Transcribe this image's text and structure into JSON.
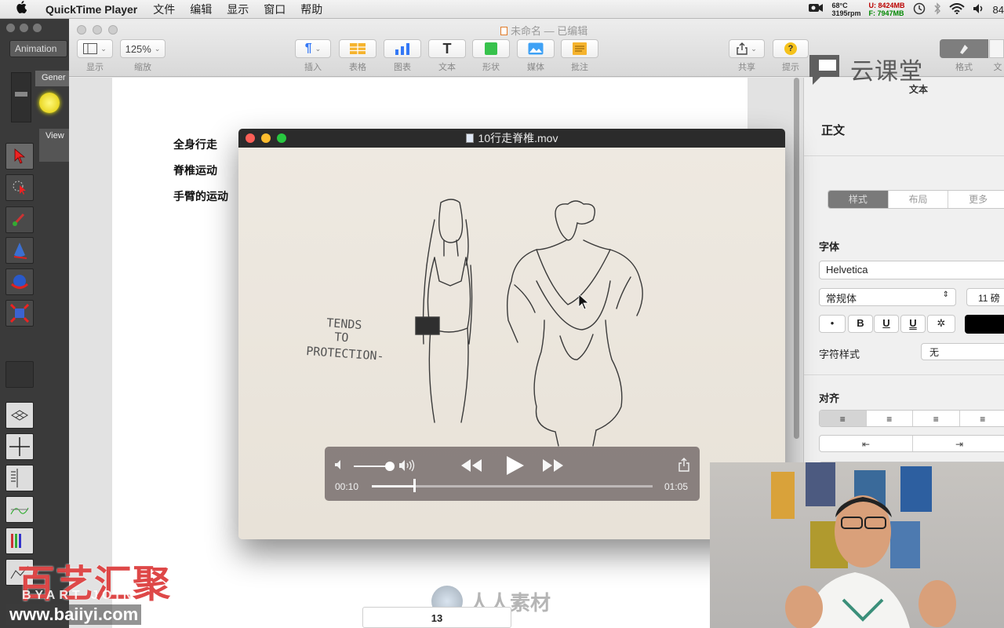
{
  "menubar": {
    "app_name": "QuickTime Player",
    "menus": [
      "文件",
      "编辑",
      "显示",
      "窗口",
      "帮助"
    ],
    "temp": "68°C",
    "rpm": "3195rpm",
    "mem_used": "U: 8424MB",
    "mem_free": "F: 7947MB",
    "battery": "84"
  },
  "left_app": {
    "tab": "Animation",
    "gen_label": "Gener",
    "view_label": "View"
  },
  "pages": {
    "doc_title": "未命名 — 已编辑",
    "toolbar": {
      "view_label": "显示",
      "zoom_value": "125%",
      "zoom_label": "缩放",
      "insert_label": "插入",
      "table_label": "表格",
      "chart_label": "图表",
      "text_label": "文本",
      "shape_label": "形状",
      "media_label": "媒体",
      "comment_label": "批注",
      "share_label": "共享",
      "tips_label": "提示",
      "format_label": "格式",
      "doc_label": "文"
    },
    "doc_lines": [
      "全身行走",
      "脊椎运动",
      "手臂的运动"
    ],
    "page_number": "13"
  },
  "inspector": {
    "tab_text": "文本",
    "style_name": "正文",
    "tabs": [
      "样式",
      "布局",
      "更多"
    ],
    "font_label": "字体",
    "font_value": "Helvetica",
    "font_style": "常规体",
    "font_size": "11 磅",
    "bullet": "•",
    "bold": "B",
    "italic_u": "U",
    "underline_u": "U",
    "gear": "✲",
    "char_style_label": "字符样式",
    "char_style_value": "无",
    "align_label": "对齐"
  },
  "video": {
    "title": "10行走脊椎.mov",
    "current_time": "00:10",
    "total_time": "01:05",
    "progress": 0.15,
    "volume": 0.6,
    "sketch_text_1": "TENDS",
    "sketch_text_2": "TO",
    "sketch_text_3": "PROTECTION-"
  },
  "watermarks": {
    "brand_cn": "百艺汇聚",
    "brand_en": "BYART JOIN",
    "url": "www.baiiyi.com",
    "cloud_class": "云课堂",
    "renren": "人人素材"
  }
}
